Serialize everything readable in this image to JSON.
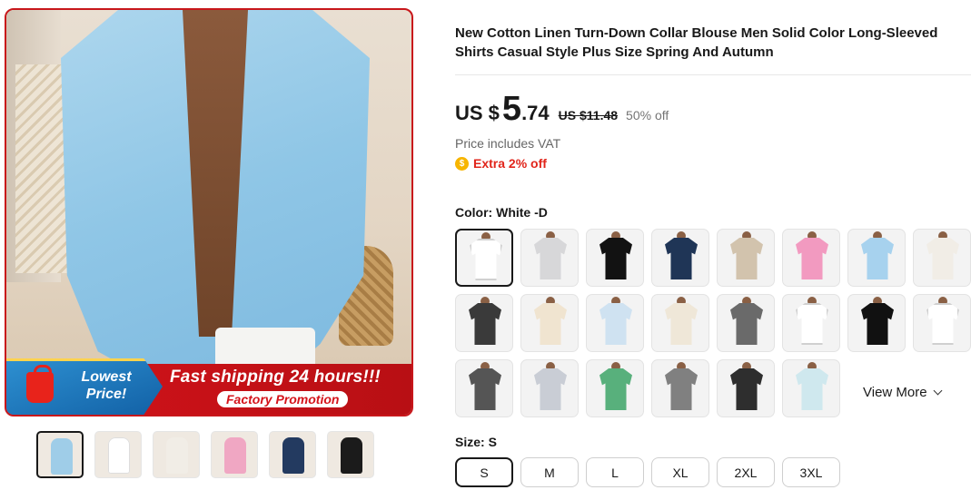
{
  "gallery": {
    "badge_line1": "Lowest",
    "badge_line2": "Price!",
    "promo_main": "Fast shipping 24 hours!!!",
    "promo_sub": "Factory Promotion",
    "thumb_colors": [
      "#9fcde8",
      "#ffffff",
      "#f1ede6",
      "#f0a7c3",
      "#233a60",
      "#1b1b1b"
    ]
  },
  "product": {
    "title": "New Cotton Linen Turn-Down Collar Blouse Men Solid Color Long-Sleeved Shirts Casual Style Plus Size Spring And Autumn",
    "currency_prefix": "US $",
    "price_int": "5",
    "price_dec": ".74",
    "price_old": "US $11.48",
    "discount": "50% off",
    "vat_note": "Price includes VAT",
    "extra_discount": "Extra 2% off",
    "coin_icon": "coin-icon"
  },
  "color": {
    "label": "Color: White -D",
    "swatches": [
      "#ffffff",
      "#d7d7d9",
      "#121212",
      "#1f3556",
      "#d2c3ad",
      "#f29ac0",
      "#a7d2ee",
      "#f1ede6",
      "#3a3a3a",
      "#f0e4d0",
      "#cfe2f1",
      "#efe7d8",
      "#6a6a6a",
      "#ffffff",
      "#111111",
      "#ffffff",
      "#555555",
      "#c9cdd5",
      "#58b07c",
      "#808080",
      "#2e2e2e",
      "#cfe8ee"
    ],
    "view_more": "View More"
  },
  "size": {
    "label": "Size: S",
    "options": [
      "S",
      "M",
      "L",
      "XL",
      "2XL",
      "3XL"
    ]
  },
  "colors": {
    "accent_red": "#e1251b",
    "text_dark": "#191919"
  }
}
